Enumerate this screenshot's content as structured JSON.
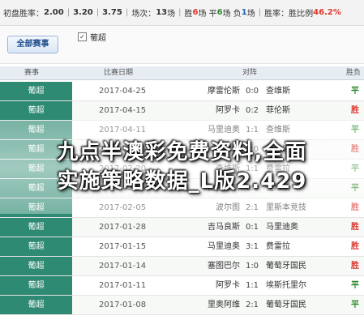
{
  "stats": {
    "init_label": "初盘胜率：",
    "v1": "2.00",
    "v2": "3.20",
    "v3": "3.75",
    "matches_label": "场次：",
    "matches": "13",
    "matches_unit": "场",
    "win_label": "胜",
    "win": "6",
    "win_unit": "场",
    "draw_label": "平",
    "draw": "6",
    "draw_unit": "场",
    "lose_label": "负",
    "lose": "1",
    "lose_unit": "场",
    "rate_label": "胜率：",
    "rate_sub": "胜比例",
    "rate": "46.2%"
  },
  "filter": {
    "all_button": "全部赛事",
    "league_checkbox": "葡超"
  },
  "table": {
    "headers": {
      "league": "赛事",
      "date": "比赛日期",
      "vs": "对阵",
      "result": "胜负"
    },
    "rows": [
      {
        "league": "葡超",
        "date": "2017-04-25",
        "home": "摩雷伦斯",
        "score": "0:0",
        "away": "查维斯",
        "result": "平"
      },
      {
        "league": "葡超",
        "date": "2017-04-15",
        "home": "阿罗卡",
        "score": "0:2",
        "away": "菲伦斯",
        "result": "胜"
      },
      {
        "league": "葡超",
        "date": "2017-04-11",
        "home": "马里迪奥",
        "score": "1:1",
        "away": "查维斯",
        "result": "平"
      },
      {
        "league": "葡超",
        "date": "2017-03-06",
        "home": "波尔图",
        "score": "2:0",
        "away": "查维斯",
        "result": "胜"
      },
      {
        "league": "葡超",
        "date": "2017-02-20",
        "home": "查维斯",
        "score": "1:1",
        "away": "费雷拉",
        "result": "平"
      },
      {
        "league": "葡超",
        "date": "2017-02-06",
        "home": "比兰尼斯",
        "score": "0:0",
        "away": "查维斯",
        "result": "平"
      },
      {
        "league": "葡超",
        "date": "2017-02-05",
        "home": "波尔图",
        "score": "2:1",
        "away": "里斯本竞技",
        "result": "胜"
      },
      {
        "league": "葡超",
        "date": "2017-01-28",
        "home": "吉马良斯",
        "score": "0:1",
        "away": "马里迪奥",
        "result": "胜"
      },
      {
        "league": "葡超",
        "date": "2017-01-15",
        "home": "马里迪奥",
        "score": "3:1",
        "away": "费雷拉",
        "result": "胜"
      },
      {
        "league": "葡超",
        "date": "2017-01-14",
        "home": "塞图巴尔",
        "score": "1:0",
        "away": "葡萄牙国民",
        "result": "胜"
      },
      {
        "league": "葡超",
        "date": "2017-01-11",
        "home": "阿罗卡",
        "score": "1:1",
        "away": "埃斯托里尔",
        "result": "平"
      },
      {
        "league": "葡超",
        "date": "2017-01-08",
        "home": "里奥阿维",
        "score": "2:1",
        "away": "葡萄牙国民",
        "result": "平"
      }
    ]
  },
  "overlay": {
    "line1": "九点半澳彩免费资料,全面",
    "line2": "实施策略数据_L版2.429"
  }
}
